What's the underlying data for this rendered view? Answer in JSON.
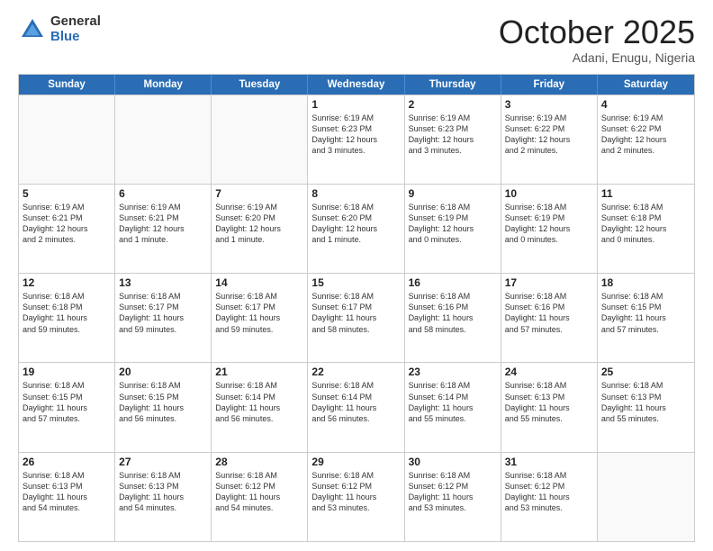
{
  "logo": {
    "general": "General",
    "blue": "Blue"
  },
  "header": {
    "month": "October 2025",
    "location": "Adani, Enugu, Nigeria"
  },
  "weekdays": [
    "Sunday",
    "Monday",
    "Tuesday",
    "Wednesday",
    "Thursday",
    "Friday",
    "Saturday"
  ],
  "weeks": [
    [
      {
        "day": "",
        "empty": true
      },
      {
        "day": "",
        "empty": true
      },
      {
        "day": "",
        "empty": true
      },
      {
        "day": "1",
        "line1": "Sunrise: 6:19 AM",
        "line2": "Sunset: 6:23 PM",
        "line3": "Daylight: 12 hours",
        "line4": "and 3 minutes."
      },
      {
        "day": "2",
        "line1": "Sunrise: 6:19 AM",
        "line2": "Sunset: 6:23 PM",
        "line3": "Daylight: 12 hours",
        "line4": "and 3 minutes."
      },
      {
        "day": "3",
        "line1": "Sunrise: 6:19 AM",
        "line2": "Sunset: 6:22 PM",
        "line3": "Daylight: 12 hours",
        "line4": "and 2 minutes."
      },
      {
        "day": "4",
        "line1": "Sunrise: 6:19 AM",
        "line2": "Sunset: 6:22 PM",
        "line3": "Daylight: 12 hours",
        "line4": "and 2 minutes."
      }
    ],
    [
      {
        "day": "5",
        "line1": "Sunrise: 6:19 AM",
        "line2": "Sunset: 6:21 PM",
        "line3": "Daylight: 12 hours",
        "line4": "and 2 minutes."
      },
      {
        "day": "6",
        "line1": "Sunrise: 6:19 AM",
        "line2": "Sunset: 6:21 PM",
        "line3": "Daylight: 12 hours",
        "line4": "and 1 minute."
      },
      {
        "day": "7",
        "line1": "Sunrise: 6:19 AM",
        "line2": "Sunset: 6:20 PM",
        "line3": "Daylight: 12 hours",
        "line4": "and 1 minute."
      },
      {
        "day": "8",
        "line1": "Sunrise: 6:18 AM",
        "line2": "Sunset: 6:20 PM",
        "line3": "Daylight: 12 hours",
        "line4": "and 1 minute."
      },
      {
        "day": "9",
        "line1": "Sunrise: 6:18 AM",
        "line2": "Sunset: 6:19 PM",
        "line3": "Daylight: 12 hours",
        "line4": "and 0 minutes."
      },
      {
        "day": "10",
        "line1": "Sunrise: 6:18 AM",
        "line2": "Sunset: 6:19 PM",
        "line3": "Daylight: 12 hours",
        "line4": "and 0 minutes."
      },
      {
        "day": "11",
        "line1": "Sunrise: 6:18 AM",
        "line2": "Sunset: 6:18 PM",
        "line3": "Daylight: 12 hours",
        "line4": "and 0 minutes."
      }
    ],
    [
      {
        "day": "12",
        "line1": "Sunrise: 6:18 AM",
        "line2": "Sunset: 6:18 PM",
        "line3": "Daylight: 11 hours",
        "line4": "and 59 minutes."
      },
      {
        "day": "13",
        "line1": "Sunrise: 6:18 AM",
        "line2": "Sunset: 6:17 PM",
        "line3": "Daylight: 11 hours",
        "line4": "and 59 minutes."
      },
      {
        "day": "14",
        "line1": "Sunrise: 6:18 AM",
        "line2": "Sunset: 6:17 PM",
        "line3": "Daylight: 11 hours",
        "line4": "and 59 minutes."
      },
      {
        "day": "15",
        "line1": "Sunrise: 6:18 AM",
        "line2": "Sunset: 6:17 PM",
        "line3": "Daylight: 11 hours",
        "line4": "and 58 minutes."
      },
      {
        "day": "16",
        "line1": "Sunrise: 6:18 AM",
        "line2": "Sunset: 6:16 PM",
        "line3": "Daylight: 11 hours",
        "line4": "and 58 minutes."
      },
      {
        "day": "17",
        "line1": "Sunrise: 6:18 AM",
        "line2": "Sunset: 6:16 PM",
        "line3": "Daylight: 11 hours",
        "line4": "and 57 minutes."
      },
      {
        "day": "18",
        "line1": "Sunrise: 6:18 AM",
        "line2": "Sunset: 6:15 PM",
        "line3": "Daylight: 11 hours",
        "line4": "and 57 minutes."
      }
    ],
    [
      {
        "day": "19",
        "line1": "Sunrise: 6:18 AM",
        "line2": "Sunset: 6:15 PM",
        "line3": "Daylight: 11 hours",
        "line4": "and 57 minutes."
      },
      {
        "day": "20",
        "line1": "Sunrise: 6:18 AM",
        "line2": "Sunset: 6:15 PM",
        "line3": "Daylight: 11 hours",
        "line4": "and 56 minutes."
      },
      {
        "day": "21",
        "line1": "Sunrise: 6:18 AM",
        "line2": "Sunset: 6:14 PM",
        "line3": "Daylight: 11 hours",
        "line4": "and 56 minutes."
      },
      {
        "day": "22",
        "line1": "Sunrise: 6:18 AM",
        "line2": "Sunset: 6:14 PM",
        "line3": "Daylight: 11 hours",
        "line4": "and 56 minutes."
      },
      {
        "day": "23",
        "line1": "Sunrise: 6:18 AM",
        "line2": "Sunset: 6:14 PM",
        "line3": "Daylight: 11 hours",
        "line4": "and 55 minutes."
      },
      {
        "day": "24",
        "line1": "Sunrise: 6:18 AM",
        "line2": "Sunset: 6:13 PM",
        "line3": "Daylight: 11 hours",
        "line4": "and 55 minutes."
      },
      {
        "day": "25",
        "line1": "Sunrise: 6:18 AM",
        "line2": "Sunset: 6:13 PM",
        "line3": "Daylight: 11 hours",
        "line4": "and 55 minutes."
      }
    ],
    [
      {
        "day": "26",
        "line1": "Sunrise: 6:18 AM",
        "line2": "Sunset: 6:13 PM",
        "line3": "Daylight: 11 hours",
        "line4": "and 54 minutes."
      },
      {
        "day": "27",
        "line1": "Sunrise: 6:18 AM",
        "line2": "Sunset: 6:13 PM",
        "line3": "Daylight: 11 hours",
        "line4": "and 54 minutes."
      },
      {
        "day": "28",
        "line1": "Sunrise: 6:18 AM",
        "line2": "Sunset: 6:12 PM",
        "line3": "Daylight: 11 hours",
        "line4": "and 54 minutes."
      },
      {
        "day": "29",
        "line1": "Sunrise: 6:18 AM",
        "line2": "Sunset: 6:12 PM",
        "line3": "Daylight: 11 hours",
        "line4": "and 53 minutes."
      },
      {
        "day": "30",
        "line1": "Sunrise: 6:18 AM",
        "line2": "Sunset: 6:12 PM",
        "line3": "Daylight: 11 hours",
        "line4": "and 53 minutes."
      },
      {
        "day": "31",
        "line1": "Sunrise: 6:18 AM",
        "line2": "Sunset: 6:12 PM",
        "line3": "Daylight: 11 hours",
        "line4": "and 53 minutes."
      },
      {
        "day": "",
        "empty": true
      }
    ]
  ]
}
